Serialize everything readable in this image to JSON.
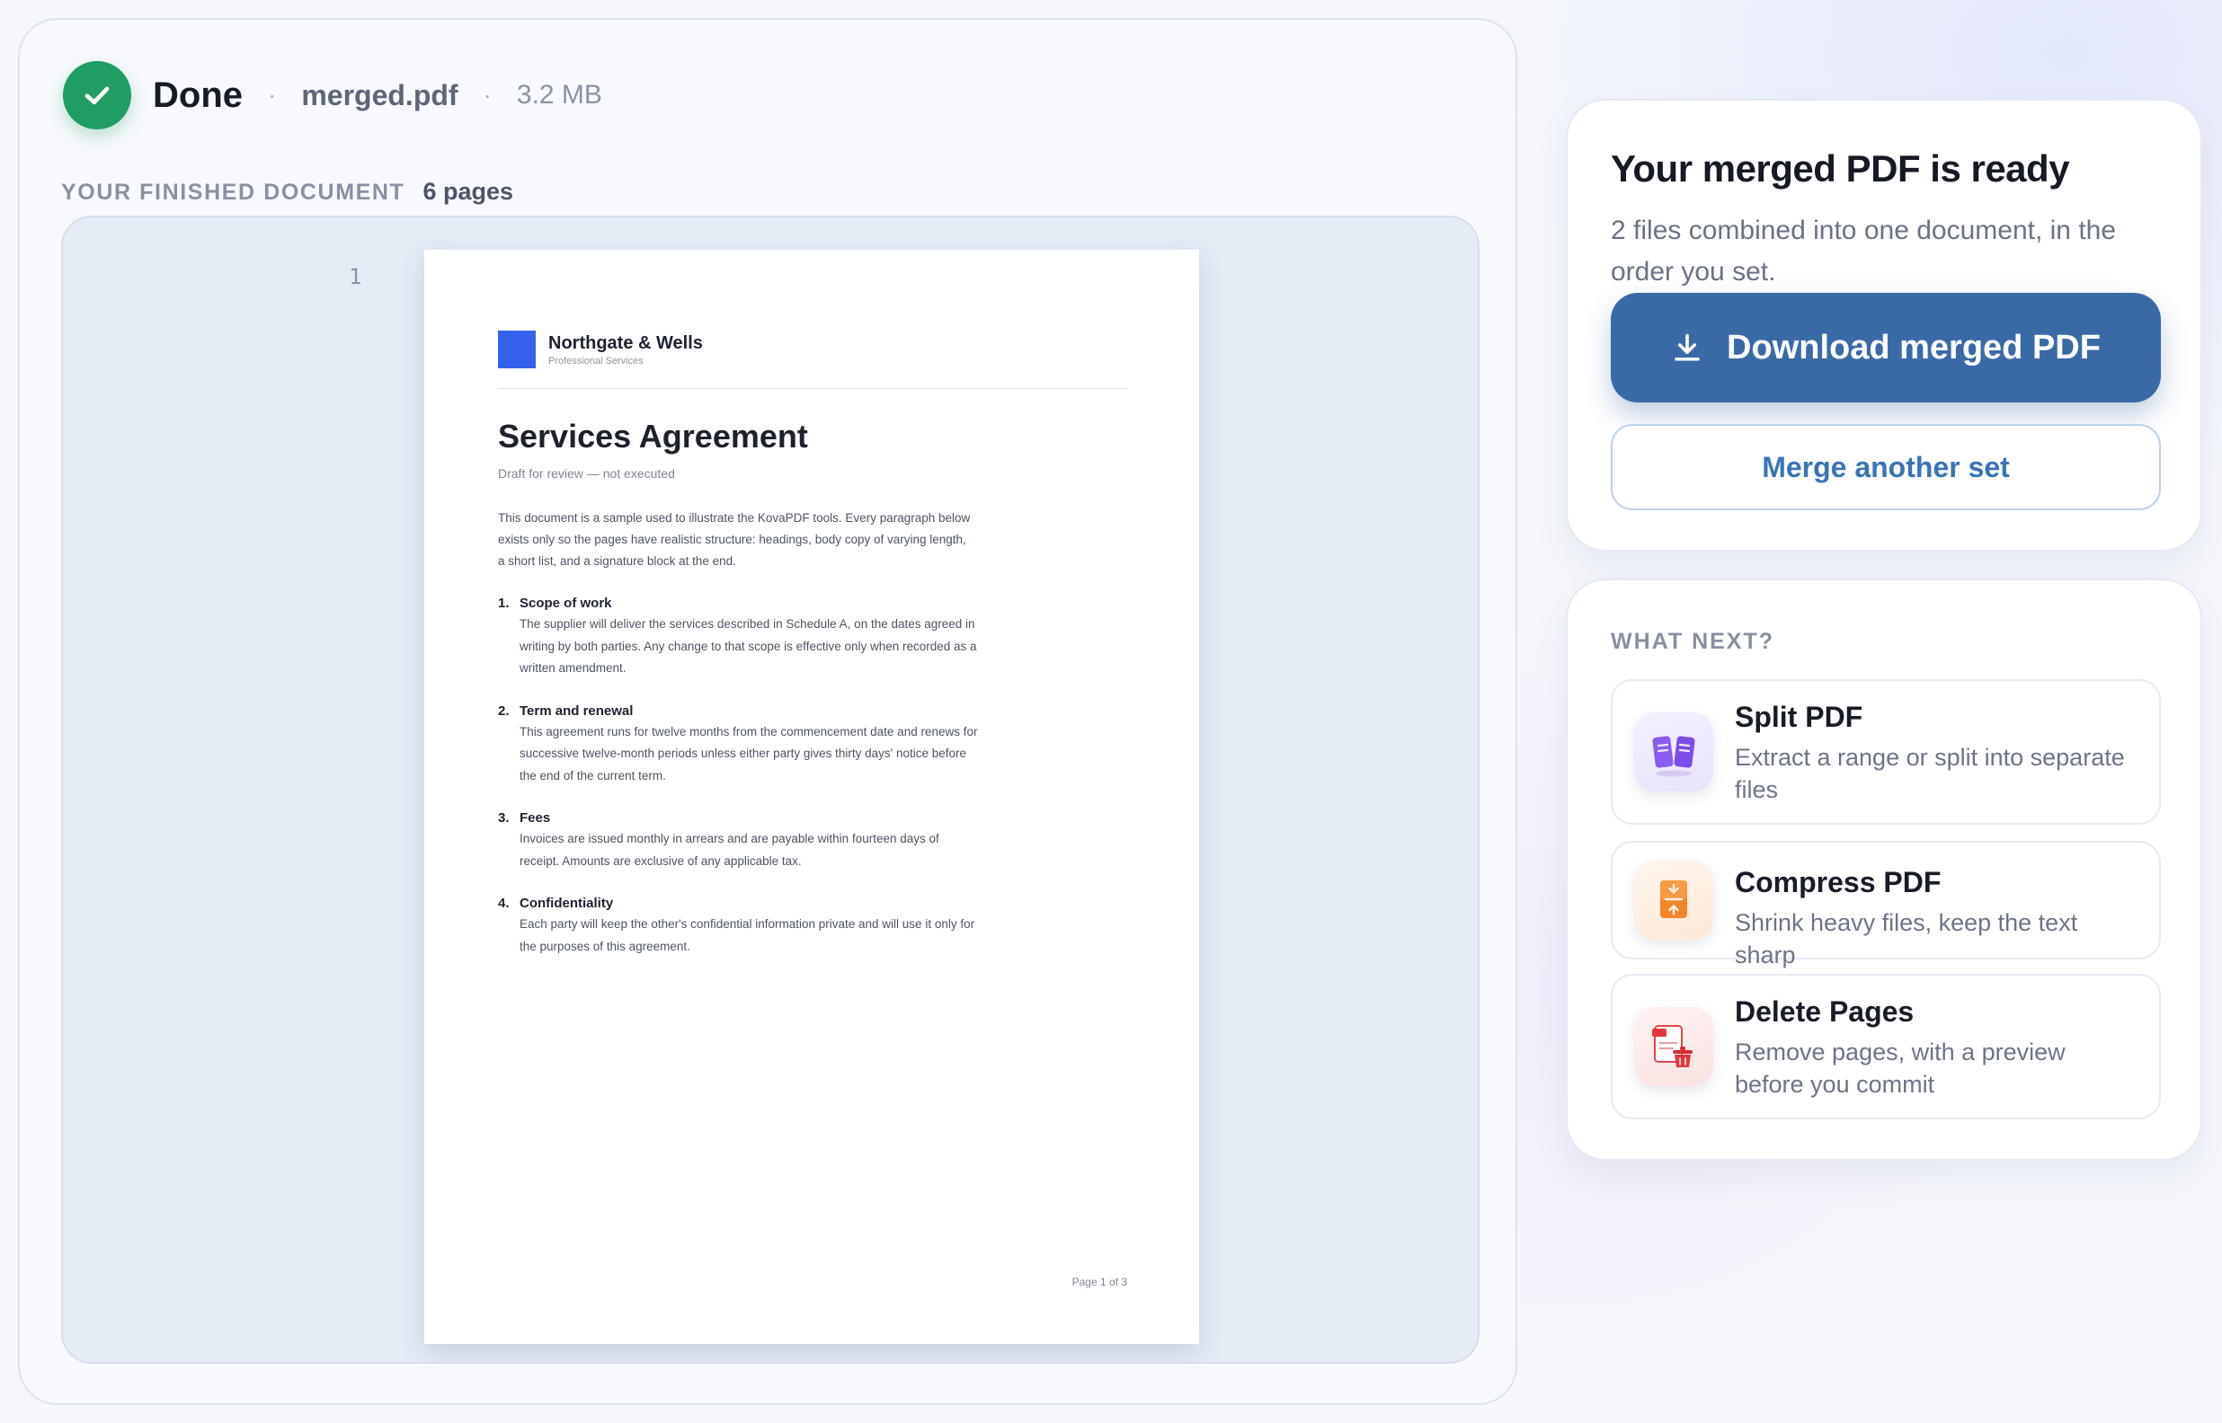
{
  "status": {
    "label": "Done",
    "file_name": "merged.pdf",
    "file_size": "3.2 MB",
    "separator": "·"
  },
  "document": {
    "caption": "YOUR FINISHED DOCUMENT",
    "pages_label": "6 pages",
    "current_page_number": "1"
  },
  "page": {
    "brand_name": "Northgate & Wells",
    "brand_sub": "Professional Services",
    "title": "Services Agreement",
    "draft_note": "Draft for review — not executed",
    "intro": "This document is a sample used to illustrate the KovaPDF tools. Every paragraph below exists only so the pages have realistic structure: headings, body copy of varying length, a short list, and a signature block at the end.",
    "clauses": [
      {
        "num": "1.",
        "title": "Scope of work",
        "body": "The supplier will deliver the services described in Schedule A, on the dates agreed in writing by both parties. Any change to that scope is effective only when recorded as a written amendment."
      },
      {
        "num": "2.",
        "title": "Term and renewal",
        "body": "This agreement runs for twelve months from the commencement date and renews for successive twelve-month periods unless either party gives thirty days' notice before the end of the current term."
      },
      {
        "num": "3.",
        "title": "Fees",
        "body": "Invoices are issued monthly in arrears and are payable within fourteen days of receipt. Amounts are exclusive of any applicable tax."
      },
      {
        "num": "4.",
        "title": "Confidentiality",
        "body": "Each party will keep the other's confidential information private and will use it only for the purposes of this agreement."
      }
    ],
    "footer": "Page 1 of 3",
    "brand_color": "#3561ea"
  },
  "ready": {
    "title": "Your merged PDF is ready",
    "subtitle": "2 files combined into one document, in the order you set.",
    "download_label": "Download merged PDF",
    "merge_label": "Merge another set",
    "accent_color": "#3a6aa6"
  },
  "next": {
    "heading": "WHAT NEXT?",
    "tools": [
      {
        "name": "Split PDF",
        "desc": "Extract a range or split into separate files",
        "icon": "split-pdf-icon"
      },
      {
        "name": "Compress PDF",
        "desc": "Shrink heavy files, keep the text sharp",
        "icon": "compress-pdf-icon"
      },
      {
        "name": "Delete Pages",
        "desc": "Remove pages, with a preview before you commit",
        "icon": "delete-pages-icon"
      }
    ]
  },
  "colors": {
    "success": "#1f9d62"
  }
}
